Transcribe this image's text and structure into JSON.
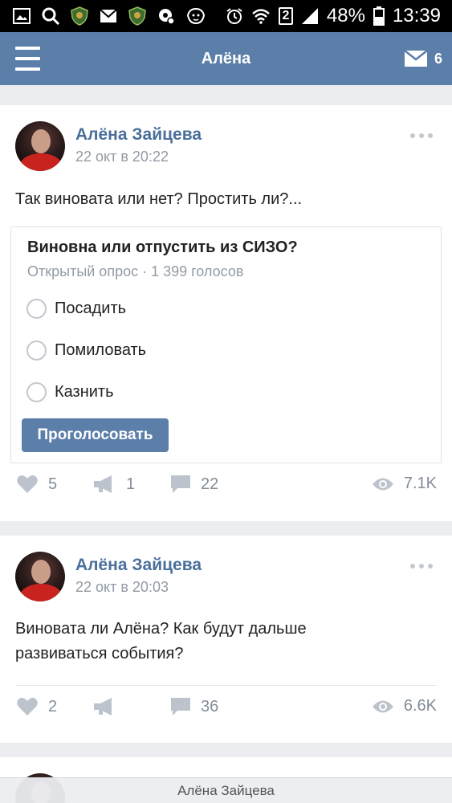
{
  "status_bar": {
    "battery": "48%",
    "time": "13:39",
    "sim": "2",
    "icons": [
      "image-icon",
      "search-icon",
      "shield-app-icon",
      "mail-icon",
      "shield-app-icon",
      "settings-icon",
      "lion-app-icon",
      "alarm-icon",
      "wifi-icon",
      "signal-icon",
      "battery-icon"
    ]
  },
  "header": {
    "title": "Алёна",
    "menu_icon": "hamburger-icon",
    "messages_icon": "envelope-icon",
    "messages_count": "6"
  },
  "posts": [
    {
      "author": "Алёна Зайцева",
      "date": "22 окт в 20:22",
      "text": "Так виновата или нет? Простить ли?...",
      "poll": {
        "question": "Виновна или отпустить из СИЗО?",
        "meta": "Открытый опрос · 1 399 голосов",
        "options": [
          "Посадить",
          "Помиловать",
          "Казнить"
        ],
        "vote_label": "Проголосовать"
      },
      "likes": "5",
      "reposts": "1",
      "comments": "22",
      "views": "7.1K"
    },
    {
      "author": "Алёна Зайцева",
      "date": "22 окт в 20:03",
      "text_line1": "Виновата ли Алёна? Как будут дальше",
      "text_line2": "развиваться события?",
      "likes": "2",
      "reposts": "",
      "comments": "36",
      "views": "6.6K"
    }
  ],
  "bottom_bar": {
    "label": "Алёна Зайцева"
  },
  "colors": {
    "header_bg": "#5b7fa8",
    "author_link": "#4a6f9a",
    "muted": "#929ba5",
    "page_bg": "#ebedf0"
  }
}
